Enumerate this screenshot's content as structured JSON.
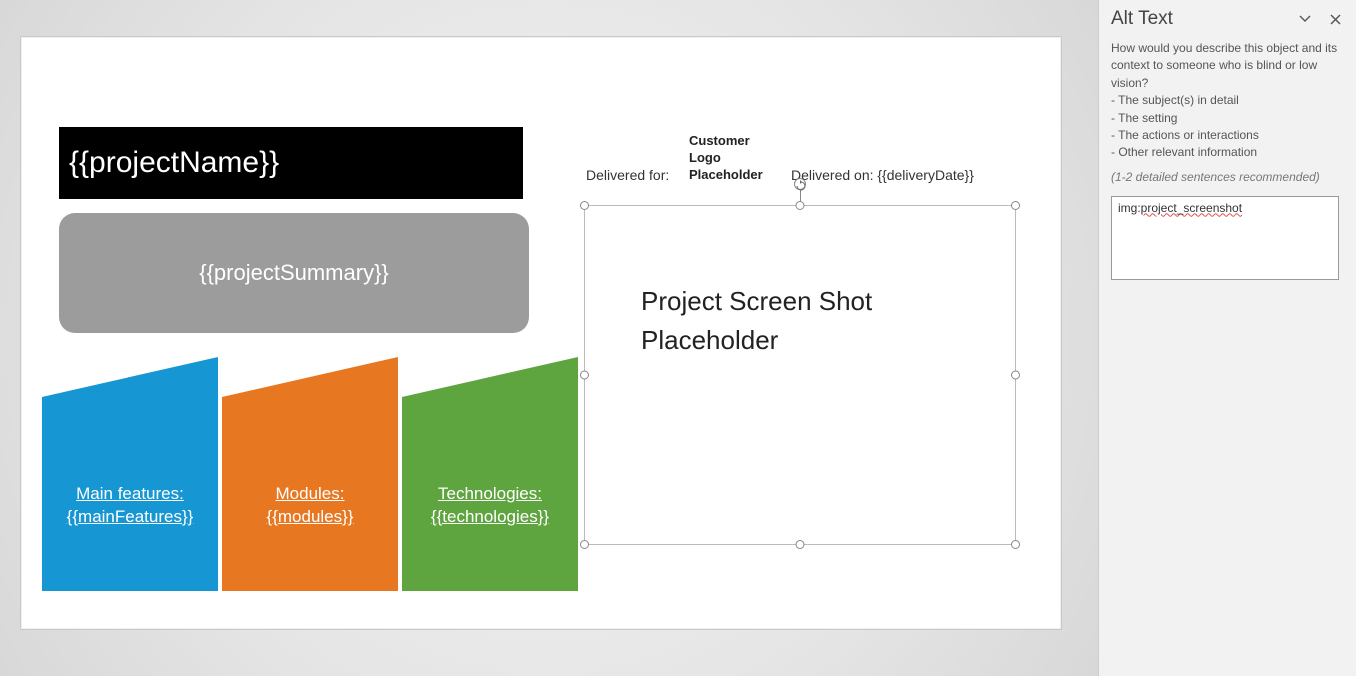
{
  "slide": {
    "title": "{{projectName}}",
    "summary": "{{projectSummary}}",
    "deliveredForLabel": "Delivered for:",
    "customerLogoText": "Customer Logo Placeholder",
    "deliveredOnLabel": "Delivered on: {{deliveryDate}}",
    "screenshotTitle": "Project Screen Shot Placeholder",
    "trapezoids": [
      {
        "label": "Main features:",
        "value": "{{mainFeatures}}",
        "color": "#1696d2"
      },
      {
        "label": "Modules:",
        "value": "{{modules}}",
        "color": "#e87722"
      },
      {
        "label": "Technologies:",
        "value": "{{technologies}}",
        "color": "#5ea43f"
      }
    ]
  },
  "altTextPanel": {
    "title": "Alt Text",
    "description": "How would you describe this object and its context to someone who is blind or low vision?",
    "bullets": [
      "- The subject(s) in detail",
      "- The setting",
      "- The actions or interactions",
      "- Other relevant information"
    ],
    "hint": "(1-2 detailed sentences recommended)",
    "valuePrefix": "img:",
    "valueSquiggle": "project_screenshot"
  }
}
